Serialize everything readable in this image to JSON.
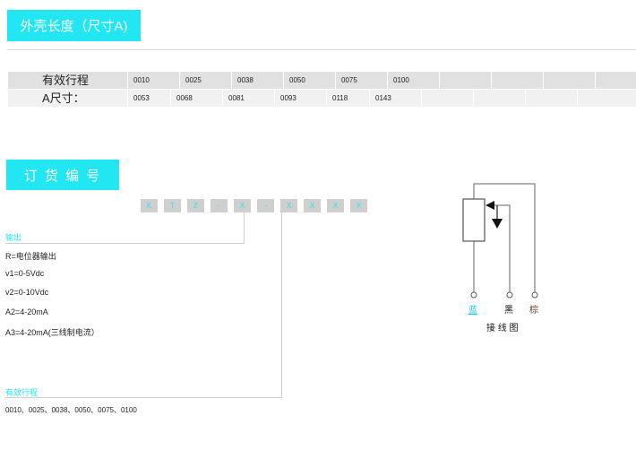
{
  "section1": {
    "title": "外壳长度（尺寸A)"
  },
  "spec_table": {
    "rows": [
      {
        "label": "有效行程",
        "values": [
          "0010",
          "0025",
          "0038",
          "0050",
          "0075",
          "0100"
        ]
      },
      {
        "label": "A尺寸：",
        "values": [
          "0053",
          "0068",
          "0081",
          "0093",
          "0118",
          "0143"
        ]
      }
    ]
  },
  "section2": {
    "title": "订 货 编 号"
  },
  "order_code": {
    "boxes": [
      "K",
      "T",
      "Z",
      "-",
      "X",
      "-",
      "X",
      "X",
      "X",
      "X"
    ]
  },
  "output": {
    "label": "输出",
    "items": [
      "R=电位器输出",
      "v1=0-5Vdc",
      "v2=0-10Vdc",
      "A2=4-20mA",
      "A3=4-20mA(三线制电流）"
    ]
  },
  "stroke": {
    "label": "有效行程",
    "values": "0010、0025、0038、0050、0075、0100"
  },
  "wiring": {
    "colors": [
      "蓝",
      "黑",
      "棕"
    ],
    "title": "接 线 图",
    "wire_colors": {
      "blue": "#22c9e6",
      "black": "#111111",
      "brown": "#6b3a1e"
    }
  }
}
